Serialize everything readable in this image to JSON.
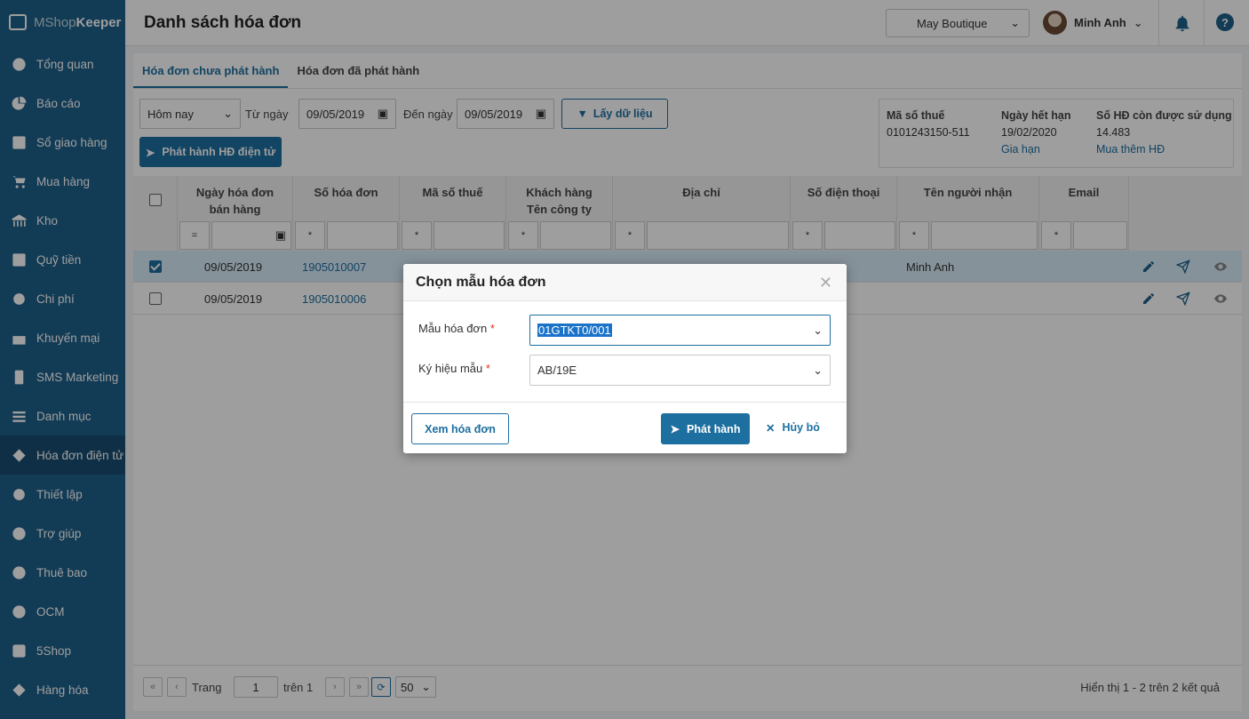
{
  "app": {
    "brand_a": "MShop",
    "brand_b": "Keeper",
    "page_title": "Danh sách hóa đơn"
  },
  "sidebar": {
    "items": [
      {
        "label": "Tổng quan",
        "icon": "dashboard-icon"
      },
      {
        "label": "Báo cáo",
        "icon": "pie-chart-icon"
      },
      {
        "label": "Sổ giao hàng",
        "icon": "delivery-book-icon"
      },
      {
        "label": "Mua hàng",
        "icon": "cart-icon"
      },
      {
        "label": "Kho",
        "icon": "warehouse-icon"
      },
      {
        "label": "Quỹ tiền",
        "icon": "safe-icon"
      },
      {
        "label": "Chi phí",
        "icon": "expense-icon"
      },
      {
        "label": "Khuyến mại",
        "icon": "gift-icon"
      },
      {
        "label": "SMS Marketing",
        "icon": "phone-icon"
      },
      {
        "label": "Danh mục",
        "icon": "list-icon"
      },
      {
        "label": "Hóa đơn điện tử",
        "icon": "e-invoice-icon"
      },
      {
        "label": "Thiết lập",
        "icon": "gear-icon"
      },
      {
        "label": "Trợ giúp",
        "icon": "help-circle-icon"
      },
      {
        "label": "Thuê bao",
        "icon": "subscription-icon"
      },
      {
        "label": "OCM",
        "icon": "ocm-icon"
      },
      {
        "label": "5Shop",
        "icon": "5shop-icon"
      },
      {
        "label": "Hàng hóa",
        "icon": "goods-icon"
      }
    ]
  },
  "header": {
    "store": "May Boutique",
    "user": "Minh Anh"
  },
  "tabs": [
    "Hóa đơn chưa phát hành",
    "Hóa đơn đã phát hành"
  ],
  "filter": {
    "period": "Hôm nay",
    "from_label": "Từ ngày",
    "from_date": "09/05/2019",
    "to_label": "Đến ngày",
    "to_date": "09/05/2019",
    "fetch_button": "Lấy dữ liệu",
    "issue_button": "Phát hành HĐ điện tử"
  },
  "info": {
    "tax_label": "Mã số thuế",
    "tax_value": "0101243150-511",
    "expiry_label": "Ngày hết hạn",
    "expiry_value": "19/02/2020",
    "renew_link": "Gia hạn",
    "remaining_label": "Số HĐ còn được sử dụng",
    "remaining_value": "14.483",
    "buy_link": "Mua thêm HĐ"
  },
  "table": {
    "headers": {
      "date_1": "Ngày hóa đơn",
      "date_2": "bán hàng",
      "number": "Số hóa đơn",
      "tax": "Mã số thuế",
      "customer_1": "Khách hàng",
      "customer_2": "Tên công ty",
      "address": "Địa chỉ",
      "phone": "Số điện thoại",
      "receiver": "Tên người nhận",
      "email": "Email"
    },
    "filter_ops": {
      "date": "=",
      "text": "*"
    },
    "rows": [
      {
        "date": "09/05/2019",
        "number": "1905010007",
        "receiver": "Minh Anh"
      },
      {
        "date": "09/05/2019",
        "number": "1905010006",
        "receiver": ""
      }
    ]
  },
  "pager": {
    "page_label": "Trang",
    "page": "1",
    "of_label": "trên 1",
    "page_size": "50",
    "summary": "Hiển thị 1 - 2 trên 2 kết quả"
  },
  "modal": {
    "title": "Chọn mẫu hóa đơn",
    "template_label": "Mẫu hóa đơn",
    "template_value": "01GTKT0/001",
    "symbol_label": "Ký hiệu mẫu",
    "symbol_value": "AB/19E",
    "required_mark": "*",
    "preview_button": "Xem hóa đơn",
    "issue_button": "Phát hành",
    "cancel_button": "Hủy bỏ"
  }
}
